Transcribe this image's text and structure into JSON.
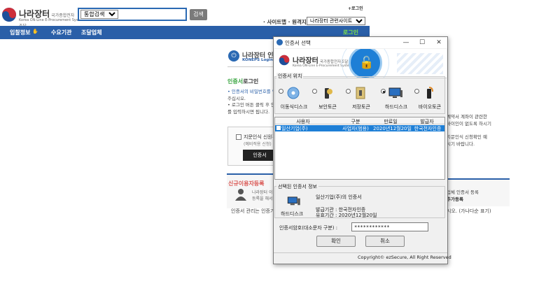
{
  "site": {
    "logo_name": "나라장터",
    "logo_sub": "국가종합전자조달",
    "logo_eng": "Korea ON-Line E-Procurement System"
  },
  "search": {
    "scope": "통합검색",
    "button": "검색"
  },
  "header": {
    "top_link": "+로그인",
    "sitemap": "· 사이트맵 · 원격지원",
    "related_select": "나라장터 관련사이트"
  },
  "nav": {
    "items": [
      "입찰정보",
      "수요기관",
      "조달업체"
    ],
    "login": "로그인"
  },
  "login_panel": {
    "title": "나라장터 인증서",
    "subtitle": "KONEPS Login",
    "section_title_green": "인증서",
    "section_title_rest": "로그인",
    "bullet_1": "• 인증서의 비밀번호를 입",
    "bullet_1b": "  주십시오.",
    "bullet_2": "• 로그인 버튼 클릭 후 인",
    "bullet_2b": "  를 입력하시면 됩니다.",
    "right_note_1": "계약서 계좌이 관련한",
    "right_note_2": "바이인이 없도록 하시기",
    "right_note_3": "지문인식 신청확인 예",
    "right_note_4": "시기 바랍니다.",
    "bio_check": "지문인식 신원확",
    "bio_sub": "(예비적용 신청)",
    "bio_button": "인증서",
    "new_user_title": "신규이용자등록",
    "new_user_desc_1": "나라장터 이",
    "new_user_desc_2": "등록을 해서",
    "right_reg_1": "업체 인증서 등록",
    "right_reg_2": "추가등록",
    "foot_left": "인증서 관리는 인증기관",
    "foot_right": "시오. (가나다순 표기)"
  },
  "dialog": {
    "title": "인증서 선택",
    "controls": [
      "—",
      "☐",
      "✕"
    ],
    "banner_name": "나라장터",
    "banner_sub": "국가종합전자조달",
    "banner_eng": "Korea ON-Line E-Procurement System",
    "location_group": "인증서 위치",
    "locations": [
      {
        "label": "이동식디스크",
        "selected": false
      },
      {
        "label": "보안토큰",
        "selected": false
      },
      {
        "label": "저장토큰",
        "selected": false
      },
      {
        "label": "하드디스크",
        "selected": true
      },
      {
        "label": "바이오토큰",
        "selected": false
      }
    ],
    "table": {
      "headers": [
        "사용자",
        "구분",
        "만료일",
        "발급자"
      ],
      "rows": [
        [
          "일산기업(주)",
          "사업자(범용)",
          "2020년12월20일",
          "한국전자인증"
        ]
      ]
    },
    "selected_group": "선택된 인증서 정보",
    "selected_device": "하드디스크",
    "selected_name": "일산기업(주)의 인증서",
    "selected_issuer": "발급기관 : 한국전자인증",
    "selected_expiry": "유효기간 : 2020년12월20일",
    "password_label": "인증서암호(대소문자 구분) :",
    "password_value": "************",
    "ok": "확인",
    "cancel": "취소",
    "copyright": "Copyright© ezSecure, All Right Reserved"
  },
  "colors": {
    "nav_blue": "#2a5fa8",
    "selection_blue": "#1e7fd6",
    "login_green": "#7ee04a"
  }
}
